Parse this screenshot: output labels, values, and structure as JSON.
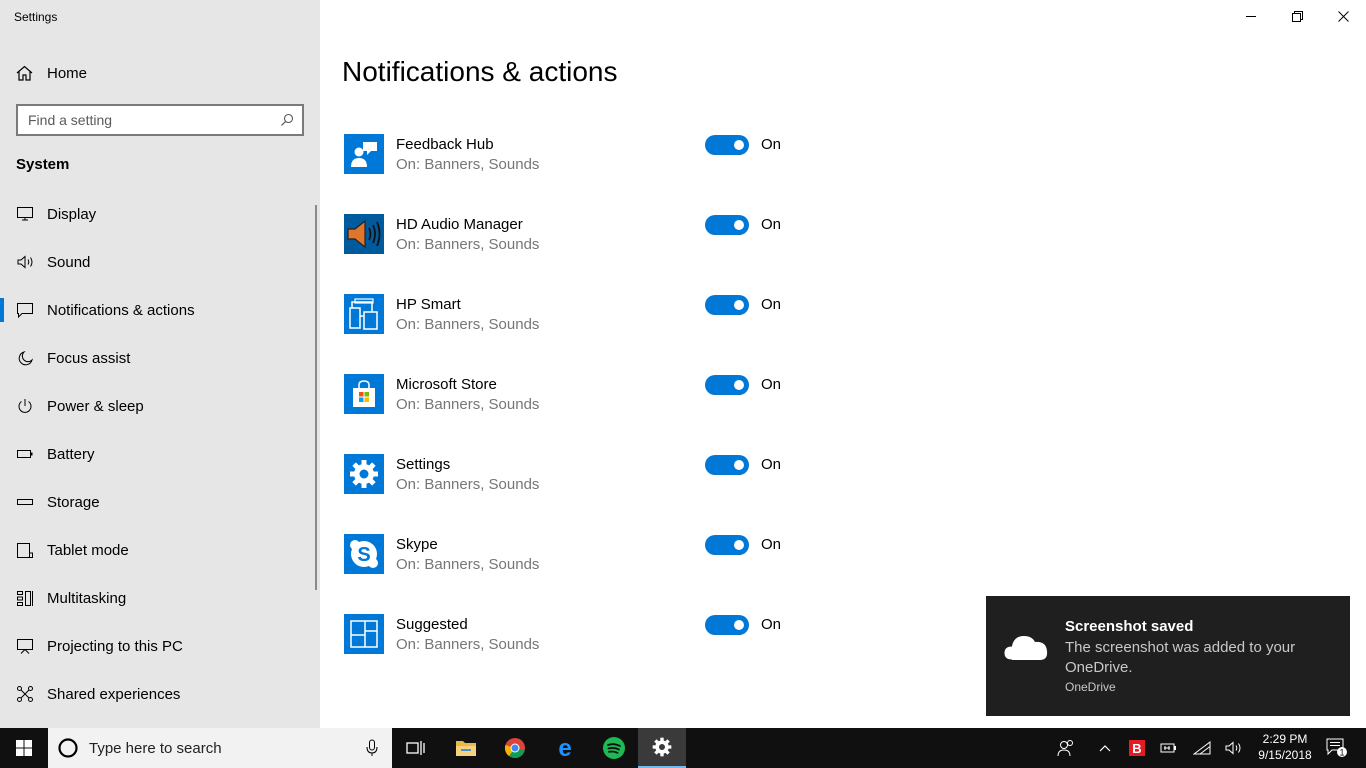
{
  "window": {
    "title": "Settings",
    "minimize_icon": "minimize-icon",
    "restore_icon": "restore-icon",
    "close_icon": "close-icon"
  },
  "sidebar": {
    "home_label": "Home",
    "search_placeholder": "Find a setting",
    "section_title": "System",
    "selected_item": "Notifications & actions",
    "items": [
      {
        "label": "Display",
        "icon": "display-icon"
      },
      {
        "label": "Sound",
        "icon": "sound-icon"
      },
      {
        "label": "Notifications & actions",
        "icon": "notifications-icon"
      },
      {
        "label": "Focus assist",
        "icon": "moon-icon"
      },
      {
        "label": "Power & sleep",
        "icon": "power-icon"
      },
      {
        "label": "Battery",
        "icon": "battery-icon"
      },
      {
        "label": "Storage",
        "icon": "storage-icon"
      },
      {
        "label": "Tablet mode",
        "icon": "tablet-icon"
      },
      {
        "label": "Multitasking",
        "icon": "multitasking-icon"
      },
      {
        "label": "Projecting to this PC",
        "icon": "projecting-icon"
      },
      {
        "label": "Shared experiences",
        "icon": "shared-experiences-icon"
      }
    ]
  },
  "main": {
    "title": "Notifications & actions",
    "apps": [
      {
        "name": "Feedback Hub",
        "status": "On: Banners, Sounds",
        "toggle": "On",
        "icon": "feedback-hub-icon"
      },
      {
        "name": "HD Audio Manager",
        "status": "On: Banners, Sounds",
        "toggle": "On",
        "icon": "speaker-icon"
      },
      {
        "name": "HP Smart",
        "status": "On: Banners, Sounds",
        "toggle": "On",
        "icon": "hp-smart-icon"
      },
      {
        "name": "Microsoft Store",
        "status": "On: Banners, Sounds",
        "toggle": "On",
        "icon": "store-icon"
      },
      {
        "name": "Settings",
        "status": "On: Banners, Sounds",
        "toggle": "On",
        "icon": "gear-icon"
      },
      {
        "name": "Skype",
        "status": "On: Banners, Sounds",
        "toggle": "On",
        "icon": "skype-icon"
      },
      {
        "name": "Suggested",
        "status": "On: Banners, Sounds",
        "toggle": "On",
        "icon": "suggested-icon"
      }
    ]
  },
  "toast": {
    "title": "Screenshot saved",
    "body": "The screenshot was added to your OneDrive.",
    "source": "OneDrive",
    "icon": "onedrive-cloud-icon"
  },
  "taskbar": {
    "search_placeholder": "Type here to search",
    "pinned": [
      "task-view-icon",
      "file-explorer-icon",
      "chrome-icon",
      "edge-icon",
      "spotify-icon",
      "settings-icon"
    ],
    "active_app": "Settings",
    "time": "2:29 PM",
    "date": "9/15/2018",
    "notification_count": "1"
  },
  "colors": {
    "accent": "#0078d7",
    "sidebar_bg": "#e6e6e6",
    "taskbar_bg": "#101010",
    "toast_bg": "#1f1f1f"
  }
}
